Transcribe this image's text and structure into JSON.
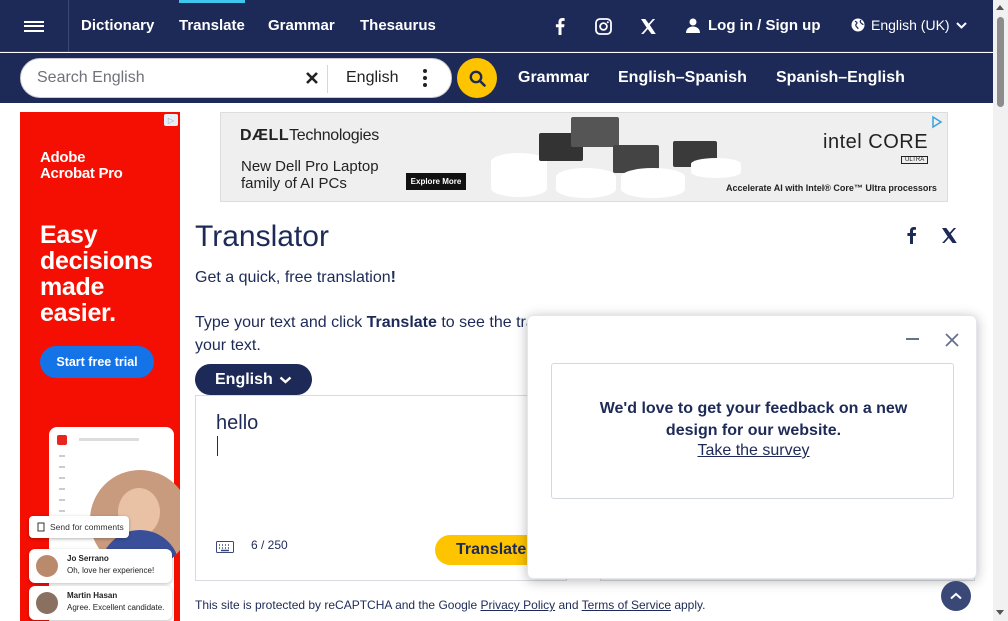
{
  "nav": {
    "items": [
      {
        "label": "Dictionary"
      },
      {
        "label": "Translate"
      },
      {
        "label": "Grammar"
      },
      {
        "label": "Thesaurus"
      }
    ],
    "login_label": "Log in / Sign up",
    "language_label": "English (UK)"
  },
  "search": {
    "placeholder": "Search English",
    "language": "English",
    "links": [
      "Grammar",
      "English–Spanish",
      "Spanish–English"
    ]
  },
  "left_ad": {
    "brand": "Adobe\nAcrobat Pro",
    "headline": "Easy\ndecisions\nmade\neasier.",
    "cta": "Start free trial",
    "comment_button": "Send for comments",
    "comments": [
      {
        "name": "Jo Serrano",
        "text": "Oh, love her experience!"
      },
      {
        "name": "Martin Hasan",
        "text": "Agree. Excellent candidate."
      }
    ]
  },
  "banner_ad": {
    "logo_bold": "DÆLL",
    "logo_rest": "Technologies",
    "copy": "New Dell Pro Laptop\nfamily of AI PCs",
    "cta": "Explore More",
    "intel_logo": "intel CORE",
    "intel_badge": "ULTRA",
    "tagline": "Accelerate AI with Intel® Core™ Ultra processors"
  },
  "translator": {
    "title": "Translator",
    "intro_prefix": "Get a quick, free translation",
    "intro_suffix": "!",
    "instr_prefix": "Type your text and click ",
    "instr_bold": "Translate",
    "instr_suffix": " to see the tra",
    "instr_tail": "your text.",
    "source_language": "English",
    "input_value": "hello",
    "char_count": "6 / 250",
    "translate_label": "Translate"
  },
  "recaptcha": {
    "prefix": "This site is protected by reCAPTCHA and the Google ",
    "privacy": "Privacy Policy",
    "and": " and ",
    "terms": "Terms of Service",
    "suffix": " apply."
  },
  "feedback": {
    "message": "We'd love to get your feedback on a new design for our website.",
    "link": "Take the survey"
  }
}
